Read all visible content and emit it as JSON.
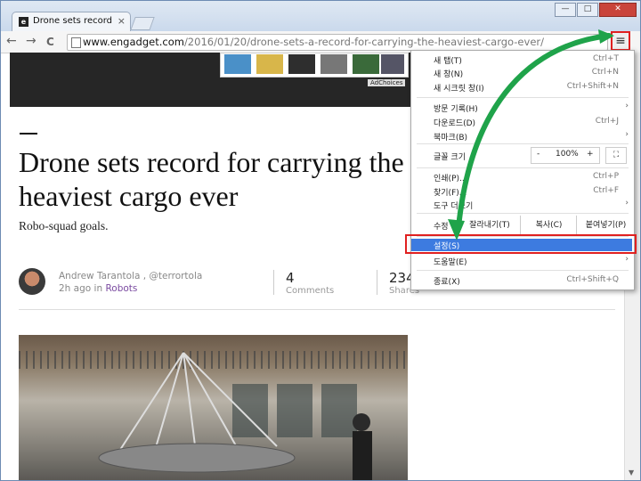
{
  "browser": {
    "tab_title": "Drone sets record for car",
    "tab_favicon": "e",
    "tab_close": "×",
    "window_minimize": "—",
    "window_maximize": "□",
    "window_close": "✕",
    "back": "←",
    "forward": "→",
    "reload": "C",
    "url_host": "www.engadget.com",
    "url_path": "/2016/01/20/drone-sets-a-record-for-carrying-the-heaviest-cargo-ever/",
    "menu_icon": "≡"
  },
  "ad": {
    "adchoices": "AdChoices"
  },
  "article": {
    "dash": "—",
    "headline_line1": "Drone sets record for carrying the",
    "headline_line2": "heaviest cargo ever",
    "subhead": "Robo-squad goals.",
    "author": "Andrew Tarantola , @terrortola",
    "posted_prefix": "2h ago in ",
    "category": "Robots",
    "comments_count": "4",
    "comments_label": "Comments",
    "shares_count": "234",
    "shares_label": "Shares"
  },
  "menu": {
    "new_tab": {
      "label": "새 탭(T)",
      "shortcut": "Ctrl+T"
    },
    "new_window": {
      "label": "새 창(N)",
      "shortcut": "Ctrl+N"
    },
    "new_incognito": {
      "label": "새 시크릿 창(I)",
      "shortcut": "Ctrl+Shift+N"
    },
    "history": {
      "label": "방문 기록(H)"
    },
    "downloads": {
      "label": "다운로드(D)",
      "shortcut": "Ctrl+J"
    },
    "bookmarks": {
      "label": "북마크(B)"
    },
    "zoom": {
      "label": "글꼴 크기",
      "minus": "-",
      "value": "100%",
      "plus": "+",
      "fullscreen": "⛶"
    },
    "print": {
      "label": "인쇄(P)...",
      "shortcut": "Ctrl+P"
    },
    "find": {
      "label": "찾기(F)...",
      "shortcut": "Ctrl+F"
    },
    "more_tools": {
      "label": "도구 더보기"
    },
    "edit": {
      "label": "수정",
      "cut": "잘라내기(T)",
      "copy": "복사(C)",
      "paste": "붙여넣기(P)"
    },
    "settings": {
      "label": "설정(S)"
    },
    "help": {
      "label": "도움말(E)"
    },
    "exit": {
      "label": "종료(X)",
      "shortcut": "Ctrl+Shift+Q"
    },
    "submenu_arrow": "›"
  },
  "scrollbar": {
    "up": "▲",
    "down": "▼"
  },
  "colors": {
    "highlight_box": "#e02020",
    "arrow_green": "#1fa34a",
    "settings_selected": "#3d7be0"
  }
}
